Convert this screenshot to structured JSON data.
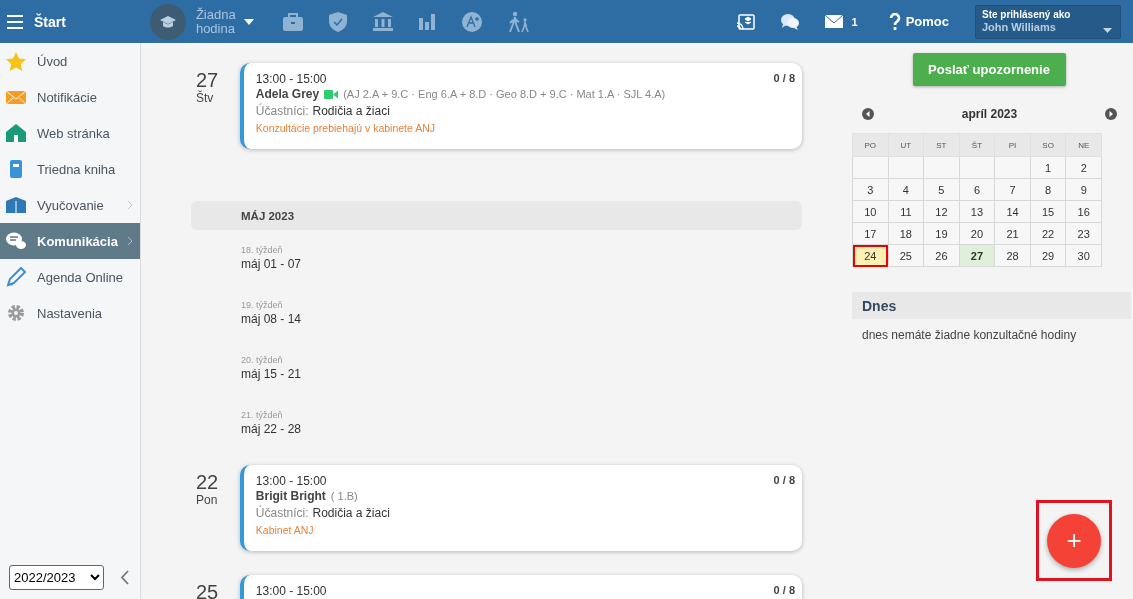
{
  "topbar": {
    "menu_label": "Štart",
    "lesson": "Žiadna hodina",
    "mail_count": "1",
    "help": "Pomoc",
    "user_label": "Ste prihlásený ako",
    "user_name": "John Williams"
  },
  "sidebar": {
    "items": [
      {
        "label": "Úvod",
        "kind": "star",
        "selected": false,
        "expandable": false
      },
      {
        "label": "Notifikácie",
        "kind": "mail",
        "selected": false,
        "expandable": false
      },
      {
        "label": "Web stránka",
        "kind": "home",
        "selected": false,
        "expandable": false
      },
      {
        "label": "Triedna kniha",
        "kind": "book",
        "selected": false,
        "expandable": false
      },
      {
        "label": "Vyučovanie",
        "kind": "open-book",
        "selected": false,
        "expandable": true
      },
      {
        "label": "Komunikácia",
        "kind": "chat",
        "selected": true,
        "expandable": true
      },
      {
        "label": "Agenda Online",
        "kind": "pen",
        "selected": false,
        "expandable": false
      },
      {
        "label": "Nastavenia",
        "kind": "gear",
        "selected": false,
        "expandable": false
      }
    ],
    "year": "2022/2023"
  },
  "schedule": [
    {
      "kind": "day",
      "day": "27",
      "weekday": "Štv",
      "time": "13:00 - 15:00",
      "teacher": "Adela Grey",
      "video": true,
      "classes": "(AJ 2.A + 9.C · Eng 6.A + 8.D · Geo 8.D + 9.C · Mat 1.A · SJL 4.A)",
      "participants_label": "Účastníci:",
      "participants": "Rodičia a žiaci",
      "note": "Konzultácie prebiehajú v kabinete ANJ",
      "count": "0 / 8"
    },
    {
      "kind": "month",
      "label": "MÁJ 2023"
    },
    {
      "kind": "week",
      "label": "18. týždeň",
      "range": "máj 01 - 07"
    },
    {
      "kind": "week",
      "label": "19. týždeň",
      "range": "máj 08 - 14"
    },
    {
      "kind": "week",
      "label": "20. týždeň",
      "range": "máj 15 - 21"
    },
    {
      "kind": "week",
      "label": "21. týždeň",
      "range": "máj 22 - 28"
    },
    {
      "kind": "day",
      "day": "22",
      "weekday": "Pon",
      "time": "13:00 - 15:00",
      "teacher": "Brigit Bright",
      "video": false,
      "classes": "( 1.B)",
      "participants_label": "Účastníci:",
      "participants": "Rodičia a žiaci",
      "note": "Kabinet ANJ",
      "count": "0 / 8"
    },
    {
      "kind": "day",
      "day": "25",
      "time": "13:00 - 15:00",
      "count": "0 / 8"
    }
  ],
  "send_button": "Poslať upozornenie",
  "calendar": {
    "month": "apríl 2023",
    "weekdays": [
      "PO",
      "UT",
      "ST",
      "ŠT",
      "PI",
      "SO",
      "NE"
    ],
    "weeks": [
      [
        {
          "day": "1",
          "today": false,
          "event": false
        },
        {
          "day": "2",
          "today": false,
          "event": false
        }
      ],
      [
        {
          "day": "3",
          "today": false,
          "event": false
        },
        {
          "day": "4",
          "today": false,
          "event": false
        },
        {
          "day": "5",
          "today": false,
          "event": false
        },
        {
          "day": "6",
          "today": false,
          "event": false
        },
        {
          "day": "7",
          "today": false,
          "event": false
        },
        {
          "day": "8",
          "today": false,
          "event": false
        },
        {
          "day": "9",
          "today": false,
          "event": false
        }
      ],
      [
        {
          "day": "10",
          "today": false,
          "event": false
        },
        {
          "day": "11",
          "today": false,
          "event": false
        },
        {
          "day": "12",
          "today": false,
          "event": false
        },
        {
          "day": "13",
          "today": false,
          "event": false
        },
        {
          "day": "14",
          "today": false,
          "event": false
        },
        {
          "day": "15",
          "today": false,
          "event": false
        },
        {
          "day": "16",
          "today": false,
          "event": false
        }
      ],
      [
        {
          "day": "17",
          "today": false,
          "event": false
        },
        {
          "day": "18",
          "today": false,
          "event": false
        },
        {
          "day": "19",
          "today": false,
          "event": false
        },
        {
          "day": "20",
          "today": false,
          "event": false
        },
        {
          "day": "21",
          "today": false,
          "event": false
        },
        {
          "day": "22",
          "today": false,
          "event": false
        },
        {
          "day": "23",
          "today": false,
          "event": false
        }
      ],
      [
        {
          "day": "24",
          "today": true,
          "event": false
        },
        {
          "day": "25",
          "today": false,
          "event": false
        },
        {
          "day": "26",
          "today": false,
          "event": false
        },
        {
          "day": "27",
          "today": false,
          "event": true
        },
        {
          "day": "28",
          "today": false,
          "event": false
        },
        {
          "day": "29",
          "today": false,
          "event": false
        },
        {
          "day": "30",
          "today": false,
          "event": false
        }
      ]
    ]
  },
  "today": {
    "title": "Dnes",
    "text": "dnes nemáte žiadne konzultačné hodiny"
  },
  "fab": {
    "label": "+",
    "highlighted": true
  }
}
